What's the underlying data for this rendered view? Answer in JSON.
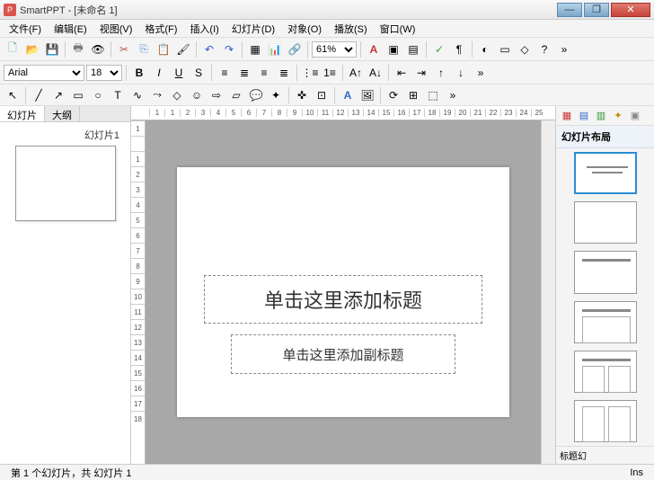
{
  "window": {
    "title": "SmartPPT - [未命名 1]",
    "min": "—",
    "max": "❐",
    "close": "✕"
  },
  "menu": [
    "文件(F)",
    "编辑(E)",
    "视图(V)",
    "格式(F)",
    "插入(I)",
    "幻灯片(D)",
    "对象(O)",
    "播放(S)",
    "窗口(W)"
  ],
  "toolbar1": {
    "zoom": "61%"
  },
  "toolbar2": {
    "font": "Arial",
    "size": "18"
  },
  "left": {
    "tab_slides": "幻灯片",
    "tab_outline": "大纲",
    "thumb1_label": "幻灯片1"
  },
  "slide": {
    "title_placeholder": "单击这里添加标题",
    "subtitle_placeholder": "单击这里添加副标题"
  },
  "right": {
    "pane_title": "幻灯片布局",
    "footer": "标题幻"
  },
  "status": {
    "left": "第 1 个幻灯片，共  幻灯片 1",
    "ins": "Ins"
  },
  "ruler_h": [
    "1",
    "1",
    "2",
    "3",
    "4",
    "5",
    "6",
    "7",
    "8",
    "9",
    "10",
    "11",
    "12",
    "13",
    "14",
    "15",
    "16",
    "17",
    "18",
    "19",
    "20",
    "21",
    "22",
    "23",
    "24",
    "25"
  ],
  "ruler_v": [
    "1",
    "",
    "1",
    "2",
    "3",
    "4",
    "5",
    "6",
    "7",
    "8",
    "9",
    "10",
    "11",
    "12",
    "13",
    "14",
    "15",
    "16",
    "17",
    "18"
  ]
}
